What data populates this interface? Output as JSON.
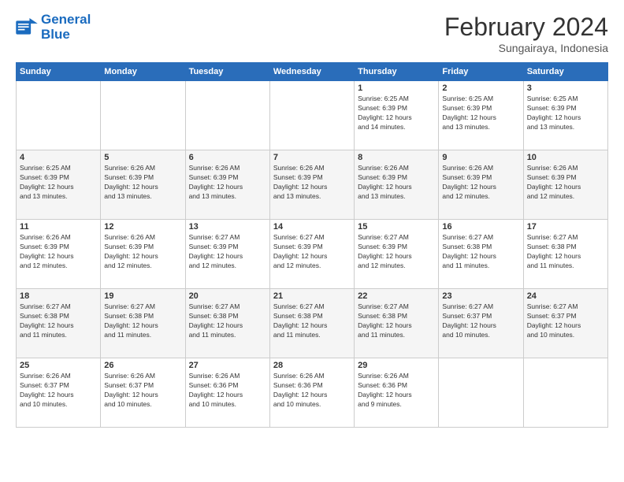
{
  "header": {
    "logo_line1": "General",
    "logo_line2": "Blue",
    "month": "February 2024",
    "location": "Sungairaya, Indonesia"
  },
  "weekdays": [
    "Sunday",
    "Monday",
    "Tuesday",
    "Wednesday",
    "Thursday",
    "Friday",
    "Saturday"
  ],
  "weeks": [
    [
      {
        "day": "",
        "info": ""
      },
      {
        "day": "",
        "info": ""
      },
      {
        "day": "",
        "info": ""
      },
      {
        "day": "",
        "info": ""
      },
      {
        "day": "1",
        "info": "Sunrise: 6:25 AM\nSunset: 6:39 PM\nDaylight: 12 hours\nand 14 minutes."
      },
      {
        "day": "2",
        "info": "Sunrise: 6:25 AM\nSunset: 6:39 PM\nDaylight: 12 hours\nand 13 minutes."
      },
      {
        "day": "3",
        "info": "Sunrise: 6:25 AM\nSunset: 6:39 PM\nDaylight: 12 hours\nand 13 minutes."
      }
    ],
    [
      {
        "day": "4",
        "info": "Sunrise: 6:25 AM\nSunset: 6:39 PM\nDaylight: 12 hours\nand 13 minutes."
      },
      {
        "day": "5",
        "info": "Sunrise: 6:26 AM\nSunset: 6:39 PM\nDaylight: 12 hours\nand 13 minutes."
      },
      {
        "day": "6",
        "info": "Sunrise: 6:26 AM\nSunset: 6:39 PM\nDaylight: 12 hours\nand 13 minutes."
      },
      {
        "day": "7",
        "info": "Sunrise: 6:26 AM\nSunset: 6:39 PM\nDaylight: 12 hours\nand 13 minutes."
      },
      {
        "day": "8",
        "info": "Sunrise: 6:26 AM\nSunset: 6:39 PM\nDaylight: 12 hours\nand 13 minutes."
      },
      {
        "day": "9",
        "info": "Sunrise: 6:26 AM\nSunset: 6:39 PM\nDaylight: 12 hours\nand 12 minutes."
      },
      {
        "day": "10",
        "info": "Sunrise: 6:26 AM\nSunset: 6:39 PM\nDaylight: 12 hours\nand 12 minutes."
      }
    ],
    [
      {
        "day": "11",
        "info": "Sunrise: 6:26 AM\nSunset: 6:39 PM\nDaylight: 12 hours\nand 12 minutes."
      },
      {
        "day": "12",
        "info": "Sunrise: 6:26 AM\nSunset: 6:39 PM\nDaylight: 12 hours\nand 12 minutes."
      },
      {
        "day": "13",
        "info": "Sunrise: 6:27 AM\nSunset: 6:39 PM\nDaylight: 12 hours\nand 12 minutes."
      },
      {
        "day": "14",
        "info": "Sunrise: 6:27 AM\nSunset: 6:39 PM\nDaylight: 12 hours\nand 12 minutes."
      },
      {
        "day": "15",
        "info": "Sunrise: 6:27 AM\nSunset: 6:39 PM\nDaylight: 12 hours\nand 12 minutes."
      },
      {
        "day": "16",
        "info": "Sunrise: 6:27 AM\nSunset: 6:38 PM\nDaylight: 12 hours\nand 11 minutes."
      },
      {
        "day": "17",
        "info": "Sunrise: 6:27 AM\nSunset: 6:38 PM\nDaylight: 12 hours\nand 11 minutes."
      }
    ],
    [
      {
        "day": "18",
        "info": "Sunrise: 6:27 AM\nSunset: 6:38 PM\nDaylight: 12 hours\nand 11 minutes."
      },
      {
        "day": "19",
        "info": "Sunrise: 6:27 AM\nSunset: 6:38 PM\nDaylight: 12 hours\nand 11 minutes."
      },
      {
        "day": "20",
        "info": "Sunrise: 6:27 AM\nSunset: 6:38 PM\nDaylight: 12 hours\nand 11 minutes."
      },
      {
        "day": "21",
        "info": "Sunrise: 6:27 AM\nSunset: 6:38 PM\nDaylight: 12 hours\nand 11 minutes."
      },
      {
        "day": "22",
        "info": "Sunrise: 6:27 AM\nSunset: 6:38 PM\nDaylight: 12 hours\nand 11 minutes."
      },
      {
        "day": "23",
        "info": "Sunrise: 6:27 AM\nSunset: 6:37 PM\nDaylight: 12 hours\nand 10 minutes."
      },
      {
        "day": "24",
        "info": "Sunrise: 6:27 AM\nSunset: 6:37 PM\nDaylight: 12 hours\nand 10 minutes."
      }
    ],
    [
      {
        "day": "25",
        "info": "Sunrise: 6:26 AM\nSunset: 6:37 PM\nDaylight: 12 hours\nand 10 minutes."
      },
      {
        "day": "26",
        "info": "Sunrise: 6:26 AM\nSunset: 6:37 PM\nDaylight: 12 hours\nand 10 minutes."
      },
      {
        "day": "27",
        "info": "Sunrise: 6:26 AM\nSunset: 6:36 PM\nDaylight: 12 hours\nand 10 minutes."
      },
      {
        "day": "28",
        "info": "Sunrise: 6:26 AM\nSunset: 6:36 PM\nDaylight: 12 hours\nand 10 minutes."
      },
      {
        "day": "29",
        "info": "Sunrise: 6:26 AM\nSunset: 6:36 PM\nDaylight: 12 hours\nand 9 minutes."
      },
      {
        "day": "",
        "info": ""
      },
      {
        "day": "",
        "info": ""
      }
    ]
  ]
}
